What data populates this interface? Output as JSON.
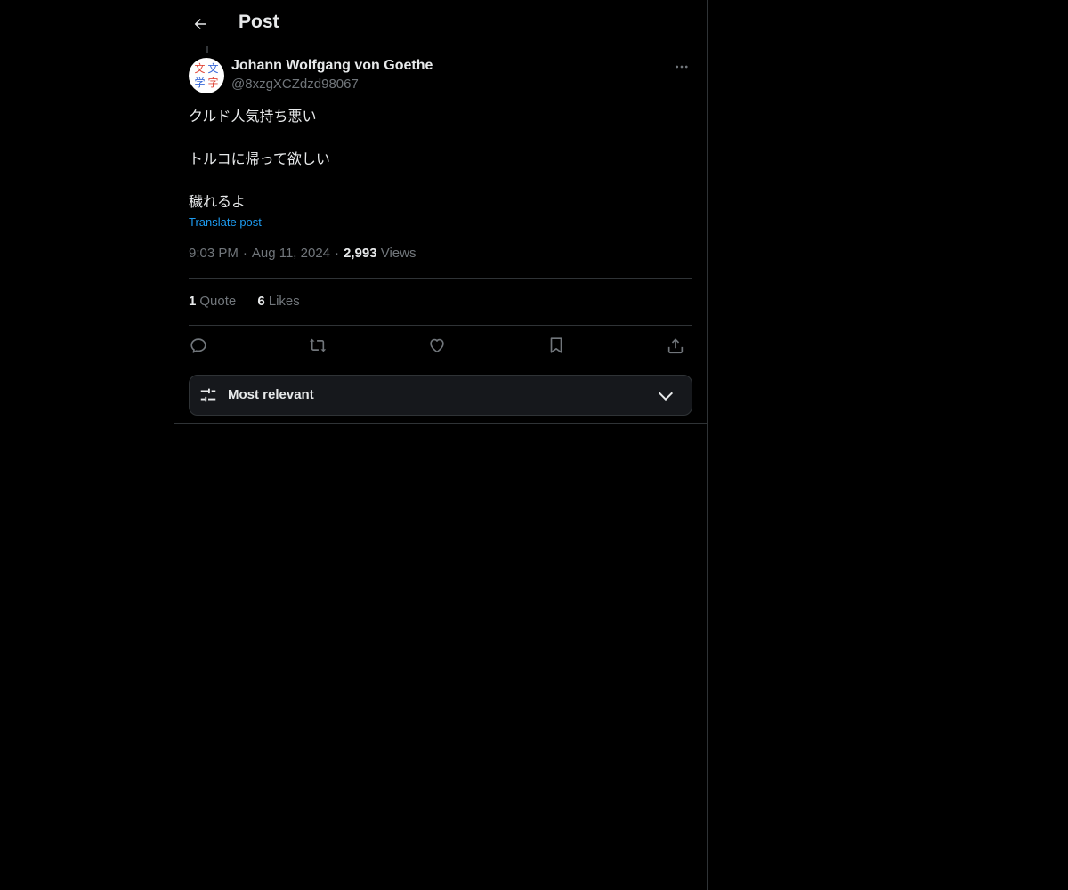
{
  "header": {
    "title": "Post",
    "back_icon": "arrow-left-icon"
  },
  "author": {
    "name": "Johann Wolfgang von Goethe",
    "handle": "@8xzgXCZdzd98067",
    "avatar_glyphs": [
      "文",
      "文",
      "学",
      "字"
    ]
  },
  "post": {
    "lines": [
      "クルド人気持ち悪い",
      "トルコに帰って欲しい",
      "穢れるよ"
    ],
    "translate_label": "Translate post",
    "time": "9:03 PM",
    "date": "Aug 11, 2024",
    "views_count": "2,993",
    "views_label": "Views"
  },
  "stats": {
    "quotes_count": "1",
    "quotes_label": "Quote",
    "likes_count": "6",
    "likes_label": "Likes"
  },
  "actions": [
    "reply-icon",
    "repost-icon",
    "like-icon",
    "bookmark-icon",
    "share-icon"
  ],
  "sort": {
    "label": "Most relevant"
  },
  "colors": {
    "background": "#000000",
    "text": "#e7e9ea",
    "secondary": "#71767b",
    "accent": "#1d9bf0",
    "border": "#2f3336"
  }
}
